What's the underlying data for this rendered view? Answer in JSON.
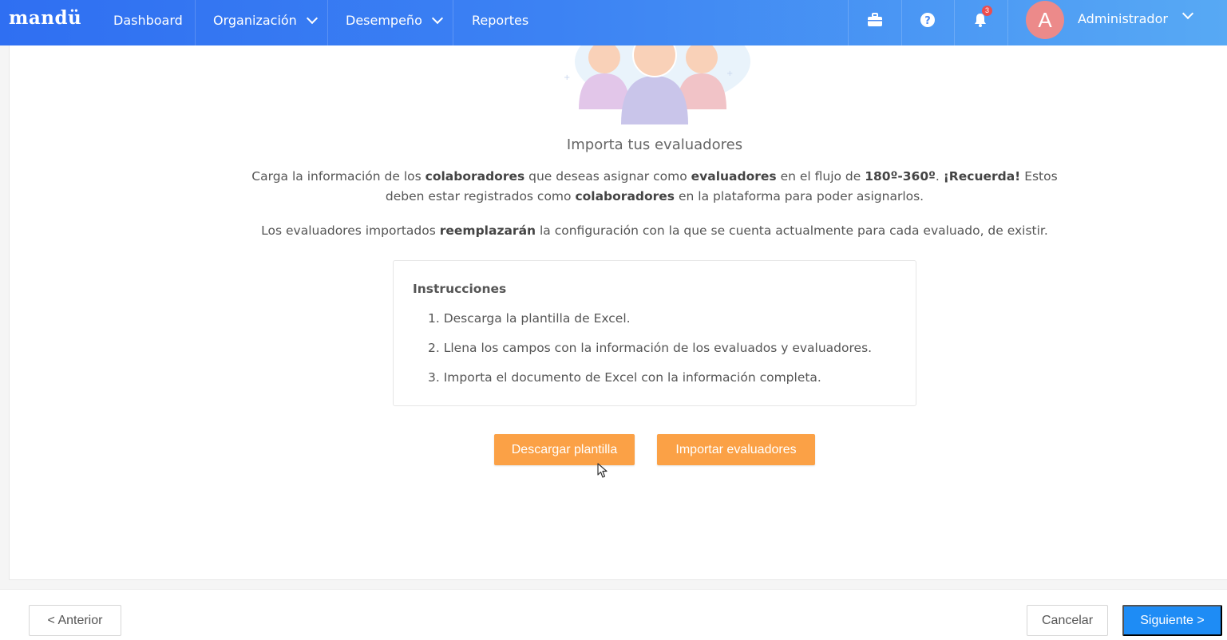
{
  "topbar": {
    "logo": "mandü",
    "nav": {
      "dashboard": "Dashboard",
      "organizacion": "Organización",
      "desempeno": "Desempeño",
      "reportes": "Reportes"
    },
    "notifications_count": "3",
    "avatar_letter": "A",
    "user_name": "Administrador"
  },
  "main": {
    "heading": "Importa tus evaluadores",
    "desc": {
      "p1": "Carga la información de los ",
      "b1": "colaboradores",
      "p2": " que deseas asignar como ",
      "b2": "evaluadores",
      "p3": " en el flujo de ",
      "b3": "180º-360º",
      "p4": ". ",
      "b4": "¡Recuerda!",
      "p5": " Estos deben estar registrados como ",
      "b5": "colaboradores",
      "p6": " en la plataforma para poder asignarlos."
    },
    "desc2": {
      "p1": "Los evaluadores importados ",
      "b1": "reemplazarán",
      "p2": " la configuración con la que se cuenta actualmente para cada evaluado, de existir."
    },
    "instructions": {
      "title": "Instrucciones",
      "items": [
        "1. Descarga la plantilla de Excel.",
        "2. Llena los campos con la información de los evaluados y evaluadores.",
        "3. Importa el documento de Excel con la información completa."
      ]
    },
    "download_button": "Descargar plantilla",
    "import_button": "Importar evaluadores"
  },
  "footer": {
    "prev_button": "< Anterior",
    "cancel_button": "Cancelar",
    "next_button": "Siguiente >"
  },
  "colors": {
    "accent_orange": "#fba146",
    "primary_blue": "#1e8cf5",
    "nav_gradient_start": "#2f6ff2",
    "nav_gradient_end": "#57a9f4"
  }
}
